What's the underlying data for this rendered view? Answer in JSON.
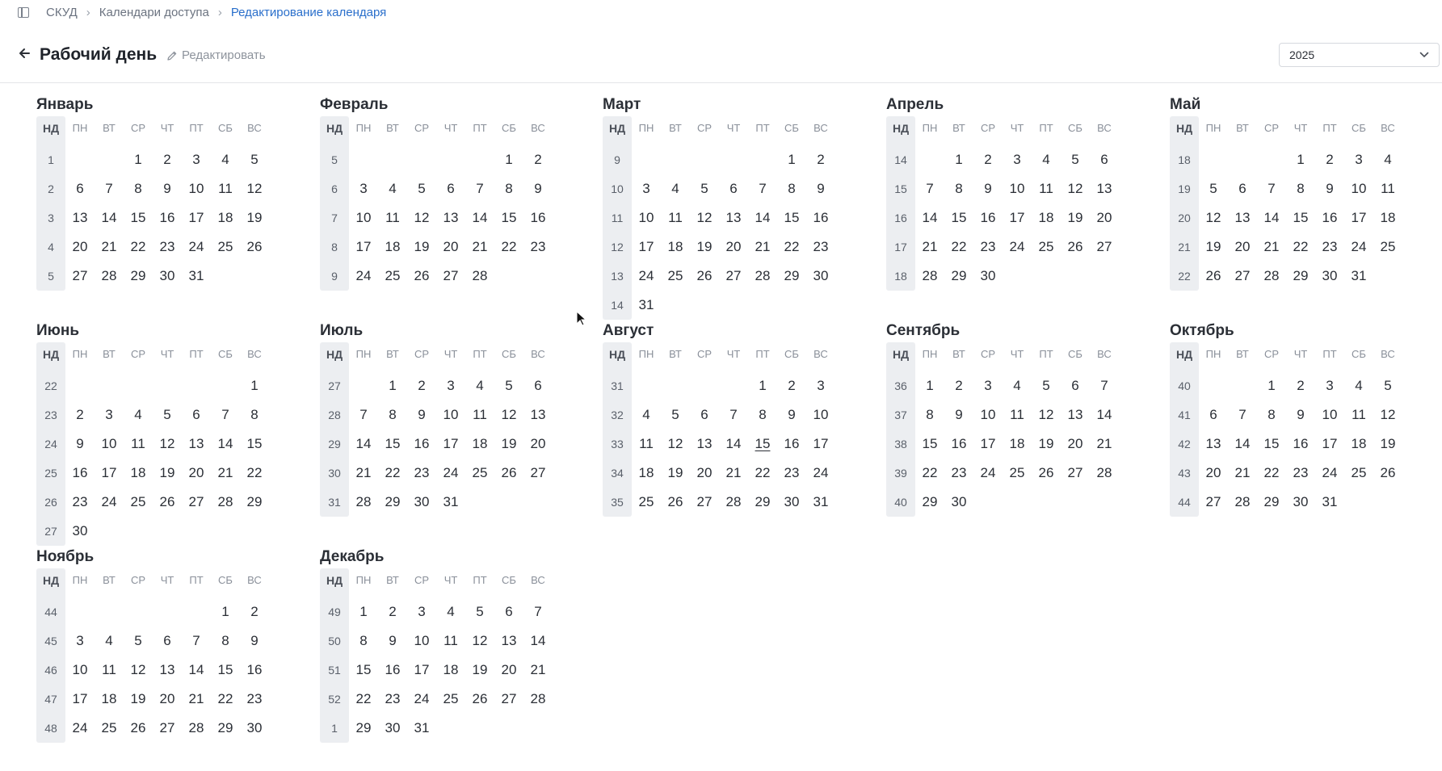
{
  "breadcrumb": [
    "СКУД",
    "Календари доступа",
    "Редактирование календаря"
  ],
  "header": {
    "title": "Рабочий день",
    "edit_label": "Редактировать"
  },
  "year_select": {
    "value": "2025"
  },
  "weekday_headers": [
    "НД",
    "ПН",
    "ВТ",
    "СР",
    "ЧТ",
    "ПТ",
    "СБ",
    "ВС"
  ],
  "colors": {
    "link": "#2a6fcb",
    "week_col_bg": "#eceef1"
  },
  "months": [
    {
      "name": "Январь",
      "rows": [
        [
          "1",
          "",
          "",
          "1",
          "2",
          "3",
          "4",
          "5"
        ],
        [
          "2",
          "6",
          "7",
          "8",
          "9",
          "10",
          "11",
          "12"
        ],
        [
          "3",
          "13",
          "14",
          "15",
          "16",
          "17",
          "18",
          "19"
        ],
        [
          "4",
          "20",
          "21",
          "22",
          "23",
          "24",
          "25",
          "26"
        ],
        [
          "5",
          "27",
          "28",
          "29",
          "30",
          "31",
          "",
          ""
        ]
      ]
    },
    {
      "name": "Февраль",
      "rows": [
        [
          "5",
          "",
          "",
          "",
          "",
          "",
          "1",
          "2"
        ],
        [
          "6",
          "3",
          "4",
          "5",
          "6",
          "7",
          "8",
          "9"
        ],
        [
          "7",
          "10",
          "11",
          "12",
          "13",
          "14",
          "15",
          "16"
        ],
        [
          "8",
          "17",
          "18",
          "19",
          "20",
          "21",
          "22",
          "23"
        ],
        [
          "9",
          "24",
          "25",
          "26",
          "27",
          "28",
          "",
          ""
        ]
      ]
    },
    {
      "name": "Март",
      "rows": [
        [
          "9",
          "",
          "",
          "",
          "",
          "",
          "1",
          "2"
        ],
        [
          "10",
          "3",
          "4",
          "5",
          "6",
          "7",
          "8",
          "9"
        ],
        [
          "11",
          "10",
          "11",
          "12",
          "13",
          "14",
          "15",
          "16"
        ],
        [
          "12",
          "17",
          "18",
          "19",
          "20",
          "21",
          "22",
          "23"
        ],
        [
          "13",
          "24",
          "25",
          "26",
          "27",
          "28",
          "29",
          "30"
        ],
        [
          "14",
          "31",
          "",
          "",
          "",
          "",
          "",
          ""
        ]
      ]
    },
    {
      "name": "Апрель",
      "rows": [
        [
          "14",
          "",
          "1",
          "2",
          "3",
          "4",
          "5",
          "6"
        ],
        [
          "15",
          "7",
          "8",
          "9",
          "10",
          "11",
          "12",
          "13"
        ],
        [
          "16",
          "14",
          "15",
          "16",
          "17",
          "18",
          "19",
          "20"
        ],
        [
          "17",
          "21",
          "22",
          "23",
          "24",
          "25",
          "26",
          "27"
        ],
        [
          "18",
          "28",
          "29",
          "30",
          "",
          "",
          "",
          ""
        ]
      ]
    },
    {
      "name": "Май",
      "rows": [
        [
          "18",
          "",
          "",
          "",
          "1",
          "2",
          "3",
          "4"
        ],
        [
          "19",
          "5",
          "6",
          "7",
          "8",
          "9",
          "10",
          "11"
        ],
        [
          "20",
          "12",
          "13",
          "14",
          "15",
          "16",
          "17",
          "18"
        ],
        [
          "21",
          "19",
          "20",
          "21",
          "22",
          "23",
          "24",
          "25"
        ],
        [
          "22",
          "26",
          "27",
          "28",
          "29",
          "30",
          "31",
          ""
        ]
      ]
    },
    {
      "name": "Июнь",
      "rows": [
        [
          "22",
          "",
          "",
          "",
          "",
          "",
          "",
          "1"
        ],
        [
          "23",
          "2",
          "3",
          "4",
          "5",
          "6",
          "7",
          "8"
        ],
        [
          "24",
          "9",
          "10",
          "11",
          "12",
          "13",
          "14",
          "15"
        ],
        [
          "25",
          "16",
          "17",
          "18",
          "19",
          "20",
          "21",
          "22"
        ],
        [
          "26",
          "23",
          "24",
          "25",
          "26",
          "27",
          "28",
          "29"
        ],
        [
          "27",
          "30",
          "",
          "",
          "",
          "",
          "",
          ""
        ]
      ]
    },
    {
      "name": "Июль",
      "rows": [
        [
          "27",
          "",
          "1",
          "2",
          "3",
          "4",
          "5",
          "6"
        ],
        [
          "28",
          "7",
          "8",
          "9",
          "10",
          "11",
          "12",
          "13"
        ],
        [
          "29",
          "14",
          "15",
          "16",
          "17",
          "18",
          "19",
          "20"
        ],
        [
          "30",
          "21",
          "22",
          "23",
          "24",
          "25",
          "26",
          "27"
        ],
        [
          "31",
          "28",
          "29",
          "30",
          "31",
          "",
          "",
          ""
        ]
      ]
    },
    {
      "name": "Август",
      "rows": [
        [
          "31",
          "",
          "",
          "",
          "",
          "1",
          "2",
          "3"
        ],
        [
          "32",
          "4",
          "5",
          "6",
          "7",
          "8",
          "9",
          "10"
        ],
        [
          "33",
          "11",
          "12",
          "13",
          "14",
          "15",
          "16",
          "17"
        ],
        [
          "34",
          "18",
          "19",
          "20",
          "21",
          "22",
          "23",
          "24"
        ],
        [
          "35",
          "25",
          "26",
          "27",
          "28",
          "29",
          "30",
          "31"
        ]
      ],
      "today": "15"
    },
    {
      "name": "Сентябрь",
      "rows": [
        [
          "36",
          "1",
          "2",
          "3",
          "4",
          "5",
          "6",
          "7"
        ],
        [
          "37",
          "8",
          "9",
          "10",
          "11",
          "12",
          "13",
          "14"
        ],
        [
          "38",
          "15",
          "16",
          "17",
          "18",
          "19",
          "20",
          "21"
        ],
        [
          "39",
          "22",
          "23",
          "24",
          "25",
          "26",
          "27",
          "28"
        ],
        [
          "40",
          "29",
          "30",
          "",
          "",
          "",
          "",
          ""
        ]
      ]
    },
    {
      "name": "Октябрь",
      "rows": [
        [
          "40",
          "",
          "",
          "1",
          "2",
          "3",
          "4",
          "5"
        ],
        [
          "41",
          "6",
          "7",
          "8",
          "9",
          "10",
          "11",
          "12"
        ],
        [
          "42",
          "13",
          "14",
          "15",
          "16",
          "17",
          "18",
          "19"
        ],
        [
          "43",
          "20",
          "21",
          "22",
          "23",
          "24",
          "25",
          "26"
        ],
        [
          "44",
          "27",
          "28",
          "29",
          "30",
          "31",
          "",
          ""
        ]
      ]
    },
    {
      "name": "Ноябрь",
      "rows": [
        [
          "44",
          "",
          "",
          "",
          "",
          "",
          "1",
          "2"
        ],
        [
          "45",
          "3",
          "4",
          "5",
          "6",
          "7",
          "8",
          "9"
        ],
        [
          "46",
          "10",
          "11",
          "12",
          "13",
          "14",
          "15",
          "16"
        ],
        [
          "47",
          "17",
          "18",
          "19",
          "20",
          "21",
          "22",
          "23"
        ],
        [
          "48",
          "24",
          "25",
          "26",
          "27",
          "28",
          "29",
          "30"
        ]
      ]
    },
    {
      "name": "Декабрь",
      "rows": [
        [
          "49",
          "1",
          "2",
          "3",
          "4",
          "5",
          "6",
          "7"
        ],
        [
          "50",
          "8",
          "9",
          "10",
          "11",
          "12",
          "13",
          "14"
        ],
        [
          "51",
          "15",
          "16",
          "17",
          "18",
          "19",
          "20",
          "21"
        ],
        [
          "52",
          "22",
          "23",
          "24",
          "25",
          "26",
          "27",
          "28"
        ],
        [
          "1",
          "29",
          "30",
          "31",
          "",
          "",
          "",
          ""
        ]
      ]
    }
  ]
}
